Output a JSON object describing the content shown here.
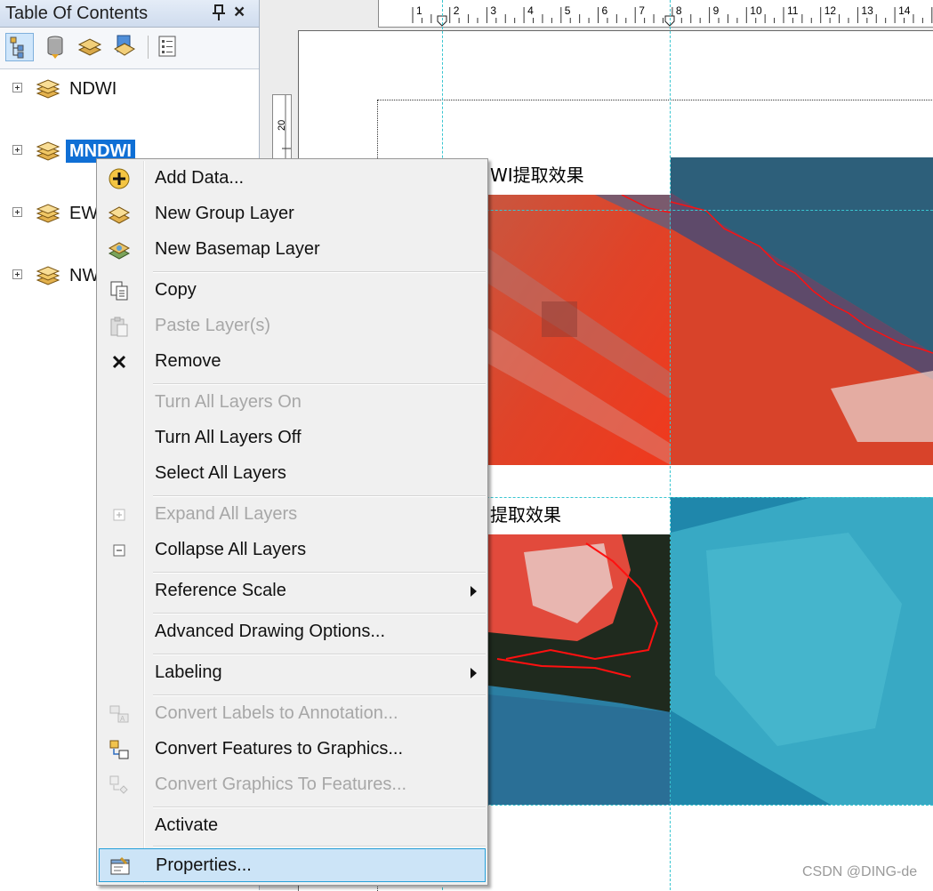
{
  "toc": {
    "title": "Table Of Contents",
    "pin_glyph": "ᵖ",
    "close_glyph": "×",
    "toolbar": [
      "list-by-drawing-order-icon",
      "list-by-source-icon",
      "list-by-visibility-icon",
      "list-by-selection-icon",
      "options-icon"
    ],
    "layers": [
      {
        "label": "NDWI",
        "selected": false
      },
      {
        "label": "MNDWI",
        "selected": true
      },
      {
        "label": "EW",
        "selected": false
      },
      {
        "label": "NW",
        "selected": false
      }
    ]
  },
  "layout": {
    "ruler_numbers": [
      "1",
      "2",
      "3",
      "4",
      "5",
      "6",
      "7",
      "8",
      "9",
      "10",
      "11",
      "12",
      "13",
      "14"
    ],
    "ruler_v_label": "20",
    "map1_title": "WI提取效果",
    "map2_title": "提取效果"
  },
  "context_menu": {
    "items": [
      {
        "label": "Add Data...",
        "icon": "add-data-icon",
        "disabled": false
      },
      {
        "label": "New Group Layer",
        "icon": "new-group-layer-icon",
        "disabled": false
      },
      {
        "label": "New Basemap Layer",
        "icon": "new-basemap-layer-icon",
        "disabled": false
      },
      {
        "label": "Copy",
        "icon": "copy-icon",
        "disabled": false
      },
      {
        "label": "Paste Layer(s)",
        "icon": "paste-icon",
        "disabled": true
      },
      {
        "label": "Remove",
        "icon": "remove-icon",
        "disabled": false
      },
      {
        "label": "Turn All Layers On",
        "icon": "",
        "disabled": true
      },
      {
        "label": "Turn All Layers Off",
        "icon": "",
        "disabled": false
      },
      {
        "label": "Select All Layers",
        "icon": "",
        "disabled": false
      },
      {
        "label": "Expand All Layers",
        "icon": "expand-icon",
        "disabled": true
      },
      {
        "label": "Collapse All Layers",
        "icon": "collapse-icon",
        "disabled": false
      },
      {
        "label": "Reference Scale",
        "icon": "",
        "disabled": false,
        "submenu": true
      },
      {
        "label": "Advanced Drawing Options...",
        "icon": "",
        "disabled": false
      },
      {
        "label": "Labeling",
        "icon": "",
        "disabled": false,
        "submenu": true
      },
      {
        "label": "Convert Labels to Annotation...",
        "icon": "convert-labels-icon",
        "disabled": true
      },
      {
        "label": "Convert Features to Graphics...",
        "icon": "convert-features-icon",
        "disabled": false
      },
      {
        "label": "Convert Graphics To Features...",
        "icon": "convert-graphics-icon",
        "disabled": true
      },
      {
        "label": "Activate",
        "icon": "",
        "disabled": false
      },
      {
        "label": "Properties...",
        "icon": "properties-icon",
        "disabled": false,
        "highlighted": true
      }
    ]
  },
  "watermark": "CSDN @DING-de",
  "colors": {
    "selection": "#0f6fd5",
    "menu_highlight": "#cce4f7",
    "guide": "#39c6d1",
    "outline_red": "#ff1010"
  }
}
